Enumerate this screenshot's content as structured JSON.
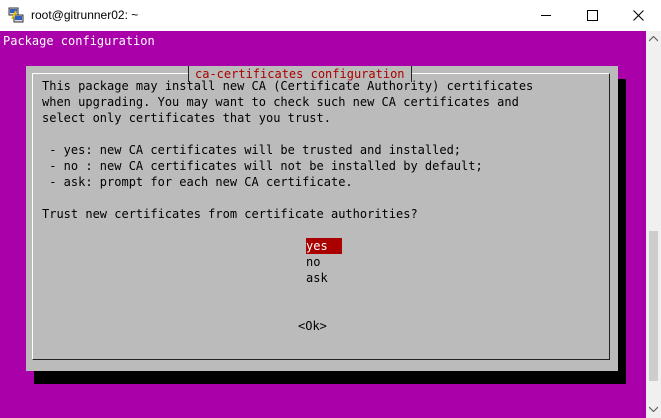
{
  "window": {
    "title": "root@gitrunner02: ~"
  },
  "terminal": {
    "header": "Package configuration"
  },
  "dialog": {
    "title": "ca-certificates configuration",
    "paragraph_lines": [
      "This package may install new CA (Certificate Authority) certificates",
      "when upgrading. You may want to check such new CA certificates and",
      "select only certificates that you trust."
    ],
    "options_lines": [
      " - yes: new CA certificates will be trusted and installed;",
      " - no : new CA certificates will not be installed by default;",
      " - ask: prompt for each new CA certificate."
    ],
    "question": "Trust new certificates from certificate authorities?",
    "choices": [
      {
        "label": "yes",
        "selected": true
      },
      {
        "label": "no",
        "selected": false
      },
      {
        "label": "ask",
        "selected": false
      }
    ],
    "ok_label": "<Ok>"
  },
  "colors": {
    "terminal_bg": "#aa00aa",
    "dialog_bg": "#bbbbbb",
    "title_fg": "#aa0000",
    "selection_bg": "#aa0000"
  }
}
